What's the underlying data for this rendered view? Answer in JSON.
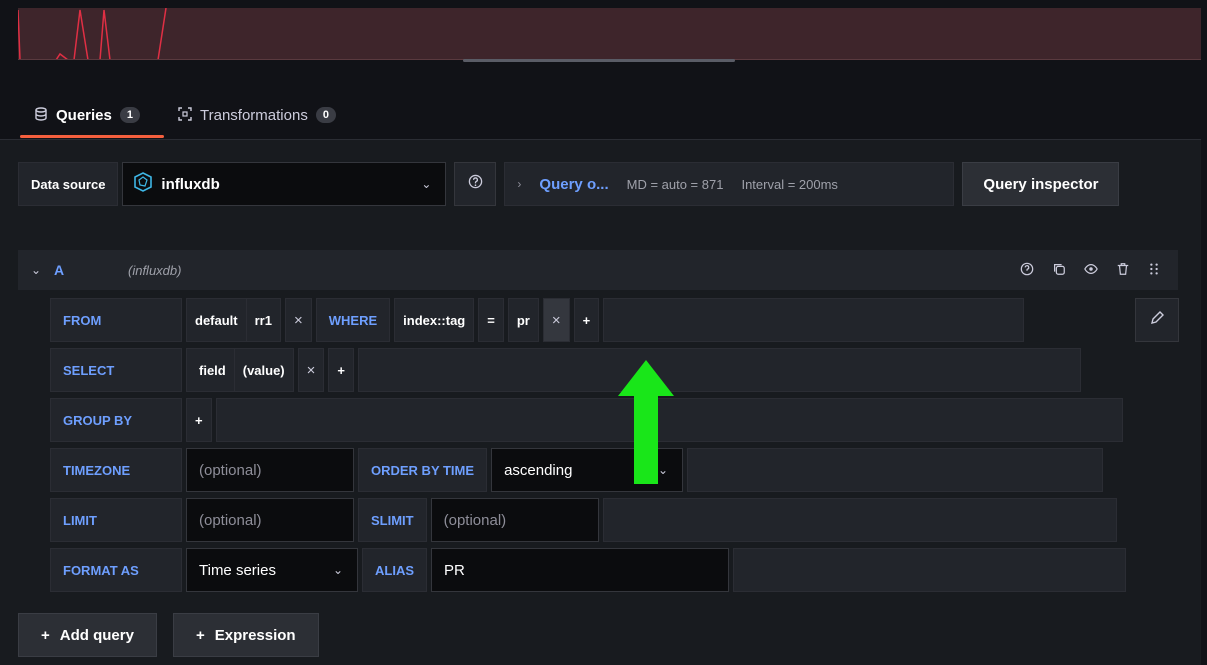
{
  "tabs": [
    {
      "label": "Queries",
      "count": "1",
      "icon": "database-icon"
    },
    {
      "label": "Transformations",
      "count": "0",
      "icon": "transform-icon"
    }
  ],
  "datasource": {
    "label": "Data source",
    "value": "influxdb",
    "query_options_label": "Query o...",
    "md": "MD = auto = 871",
    "interval": "Interval = 200ms",
    "inspector_label": "Query inspector"
  },
  "query": {
    "ref_id": "A",
    "datasource": "(influxdb)",
    "from": {
      "keyword": "FROM",
      "policy": "default",
      "measurement": "rr1",
      "remove": "×",
      "where_keyword": "WHERE",
      "tag_key": "index::tag",
      "operator": "=",
      "tag_value": "pr",
      "remove_condition": "×",
      "add": "+"
    },
    "select": {
      "keyword": "SELECT",
      "field": "field",
      "value": "(value)",
      "remove": "×",
      "add": "+"
    },
    "group_by": {
      "keyword": "GROUP BY",
      "add": "+"
    },
    "timezone": {
      "keyword": "TIMEZONE",
      "placeholder": "(optional)",
      "order_keyword": "ORDER BY TIME",
      "order_value": "ascending"
    },
    "limit": {
      "keyword": "LIMIT",
      "placeholder": "(optional)",
      "slimit_keyword": "SLIMIT",
      "slimit_placeholder": "(optional)"
    },
    "format": {
      "keyword": "FORMAT AS",
      "value": "Time series",
      "alias_keyword": "ALIAS",
      "alias_value": "PR"
    }
  },
  "buttons": {
    "add_query": "Add query",
    "expression": "Expression",
    "plus": "+"
  },
  "colors": {
    "accent": "#6e9fff",
    "tab_underline": "#f55f3e",
    "arrow": "#19e619",
    "chart_bg": "#3e252b",
    "series": "#e02f44"
  }
}
